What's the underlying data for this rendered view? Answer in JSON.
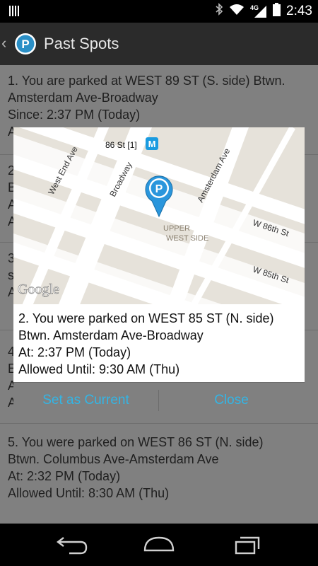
{
  "status_bar": {
    "time": "2:43",
    "network": "4G",
    "icons": [
      "notification-bars-icon",
      "bluetooth-icon",
      "wifi-icon",
      "cell-signal-icon",
      "battery-icon"
    ]
  },
  "action_bar": {
    "title": "Past Spots",
    "logo_icon": "parking-logo-icon",
    "logo_letter": "P",
    "up_icon": "chevron-left-icon"
  },
  "past_spots": [
    {
      "lines": [
        "1. You are parked at WEST 89 ST (S. side) Btwn.",
        "Amsterdam Ave-Broadway",
        "Since: 2:37 PM (Today)",
        "A"
      ]
    },
    {
      "lines": [
        "2",
        "B",
        "A",
        "A"
      ]
    },
    {
      "lines": [
        "3",
        "s",
        "A"
      ]
    },
    {
      "lines": [
        "4",
        "E",
        "A",
        "A"
      ]
    },
    {
      "lines": [
        "5. You were parked on WEST 86 ST (N. side)",
        "Btwn. Columbus Ave-Amsterdam Ave",
        "At: 2:32 PM (Today)",
        "Allowed Until: 8:30 AM (Thu)"
      ]
    }
  ],
  "dialog": {
    "map": {
      "streets": [
        "West End Ave",
        "Broadway",
        "Amsterdam Ave",
        "W 86th St",
        "W 85th St"
      ],
      "neighborhood_line1": "UPPER",
      "neighborhood_line2": "WEST SIDE",
      "station_label": "86 St [1]",
      "metro_letter": "M",
      "watermark": "Google",
      "marker_letter": "P"
    },
    "info_lines": [
      "2. You were parked on WEST 85 ST (N. side)",
      "Btwn. Amsterdam Ave-Broadway",
      "At: 2:37 PM (Today)",
      "Allowed Until: 9:30 AM (Thu)"
    ],
    "buttons": {
      "set_current": "Set as Current",
      "close": "Close"
    },
    "accent_color": "#33b5e5"
  },
  "nav_bar": {
    "icons": [
      "back-icon",
      "home-icon",
      "recents-icon"
    ]
  }
}
